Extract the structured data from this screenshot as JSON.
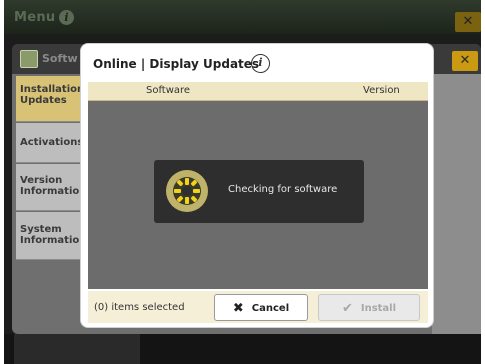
{
  "menu": {
    "title": "Menu",
    "info_icon": "info-icon",
    "close_icon": "close-icon"
  },
  "software_window": {
    "title": "Softw",
    "tabs": [
      {
        "label": "Installation Updates",
        "active": true
      },
      {
        "label": "Activations",
        "active": false
      },
      {
        "label": "Version Information",
        "active": false
      },
      {
        "label": "System Information",
        "active": false
      }
    ]
  },
  "dialog": {
    "title": "Online | Display Updates",
    "info_icon": "info-icon",
    "columns": {
      "software": "Software",
      "version": "Version"
    },
    "checking_text": "Checking for software",
    "items_selected": "(0) items selected",
    "cancel_label": "Cancel",
    "install_label": "Install"
  },
  "colors": {
    "accent": "#c99a12",
    "header_band": "#efe6c4",
    "active_tab": "#d7c276"
  }
}
